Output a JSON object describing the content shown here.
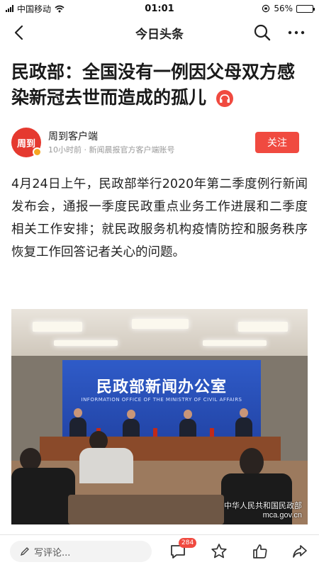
{
  "status_bar": {
    "carrier": "中国移动",
    "time": "01:01",
    "battery_percent": "56%",
    "battery_level": 0.56
  },
  "nav": {
    "title": "今日头条"
  },
  "article": {
    "headline": "民政部：全国没有一例因父母双方感染新冠去世而造成的孤儿",
    "author": {
      "avatar_text": "周到",
      "name": "周到客户端",
      "meta": "10小时前 · 新闻晨报官方客户端账号",
      "follow_label": "关注"
    },
    "body": "4月24日上午，民政部举行2020年第二季度例行新闻发布会，通报一季度民政重点业务工作进展和二季度相关工作安排；就民政服务机构疫情防控和服务秩序恢复工作回答记者关心的问题。",
    "photo": {
      "backdrop_title": "民政部新闻办公室",
      "backdrop_subtitle": "INFORMATION OFFICE OF THE MINISTRY OF CIVIL AFFAIRS",
      "watermark_line1": "中华人民共和国民政部",
      "watermark_line2": "mca.gov.cn"
    }
  },
  "bottom_bar": {
    "comment_placeholder": "写评论...",
    "comment_count": "284"
  },
  "colors": {
    "accent_red": "#f04a40",
    "backdrop_blue": "#2f5bc8"
  },
  "icons": [
    "back-arrow-icon",
    "search-icon",
    "more-icon",
    "listen-icon",
    "pencil-icon",
    "comment-icon",
    "star-icon",
    "like-icon",
    "share-icon"
  ]
}
